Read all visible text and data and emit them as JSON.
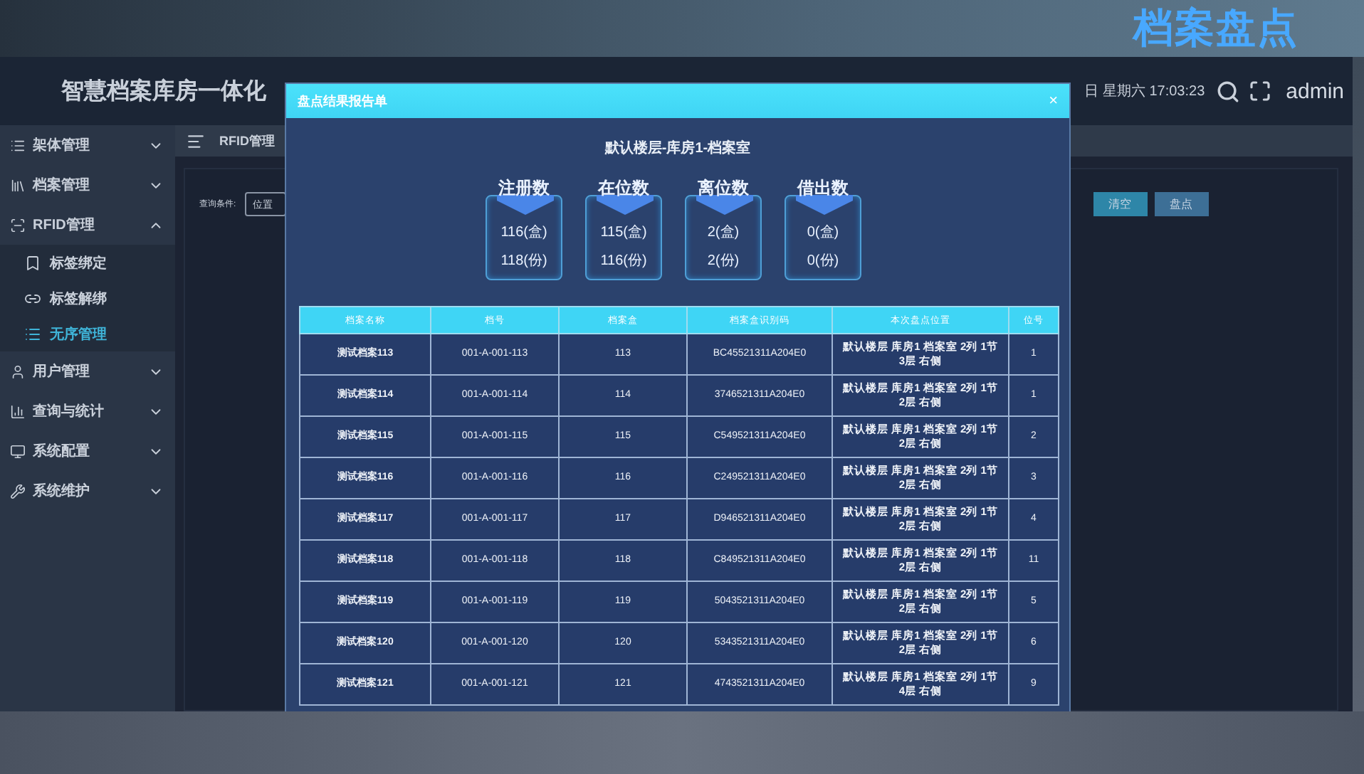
{
  "caption": "档案盘点",
  "header": {
    "title": "智慧档案库房一体化",
    "datetime": "日 星期六 17:03:23",
    "user": "admin"
  },
  "sidebar": {
    "items": [
      {
        "label": "架体管理",
        "expanded": false
      },
      {
        "label": "档案管理",
        "expanded": false
      },
      {
        "label": "RFID管理",
        "expanded": true,
        "children": [
          {
            "label": "标签绑定",
            "selected": false
          },
          {
            "label": "标签解绑",
            "selected": false
          },
          {
            "label": "无序管理",
            "selected": true
          }
        ]
      },
      {
        "label": "用户管理",
        "expanded": false
      },
      {
        "label": "查询与统计",
        "expanded": false
      },
      {
        "label": "系统配置",
        "expanded": false
      },
      {
        "label": "系统维护",
        "expanded": false
      }
    ]
  },
  "tab": {
    "label": "RFID管理"
  },
  "query": {
    "label": "查询条件:",
    "select_value": "位置",
    "buttons": [
      {
        "label": "清空",
        "kind": "primary"
      },
      {
        "label": "盘点",
        "kind": "secondary"
      }
    ]
  },
  "dialog": {
    "title": "盘点结果报告单",
    "close": "×",
    "subtitle": "默认楼层-库房1-档案室",
    "stats": [
      {
        "label": "注册数",
        "boxes": "116(盒)",
        "copies": "118(份)"
      },
      {
        "label": "在位数",
        "boxes": "115(盒)",
        "copies": "116(份)"
      },
      {
        "label": "离位数",
        "boxes": "2(盒)",
        "copies": "2(份)"
      },
      {
        "label": "借出数",
        "boxes": "0(盒)",
        "copies": "0(份)"
      }
    ],
    "table": {
      "columns": [
        "档案名称",
        "档号",
        "档案盒",
        "档案盒识别码",
        "本次盘点位置",
        "位号"
      ],
      "rows": [
        [
          "测试档案113",
          "001-A-001-113",
          "113",
          "BC45521311A204E0",
          "默认楼层 库房1 档案室 2列 1节 3层 右侧",
          "1"
        ],
        [
          "测试档案114",
          "001-A-001-114",
          "114",
          "3746521311A204E0",
          "默认楼层 库房1 档案室 2列 1节 2层 右侧",
          "1"
        ],
        [
          "测试档案115",
          "001-A-001-115",
          "115",
          "C549521311A204E0",
          "默认楼层 库房1 档案室 2列 1节 2层 右侧",
          "2"
        ],
        [
          "测试档案116",
          "001-A-001-116",
          "116",
          "C249521311A204E0",
          "默认楼层 库房1 档案室 2列 1节 2层 右侧",
          "3"
        ],
        [
          "测试档案117",
          "001-A-001-117",
          "117",
          "D946521311A204E0",
          "默认楼层 库房1 档案室 2列 1节 2层 右侧",
          "4"
        ],
        [
          "测试档案118",
          "001-A-001-118",
          "118",
          "C849521311A204E0",
          "默认楼层 库房1 档案室 2列 1节 2层 右侧",
          "11"
        ],
        [
          "测试档案119",
          "001-A-001-119",
          "119",
          "5043521311A204E0",
          "默认楼层 库房1 档案室 2列 1节 2层 右侧",
          "5"
        ],
        [
          "测试档案120",
          "001-A-001-120",
          "120",
          "5343521311A204E0",
          "默认楼层 库房1 档案室 2列 1节 2层 右侧",
          "6"
        ],
        [
          "测试档案121",
          "001-A-001-121",
          "121",
          "4743521311A204E0",
          "默认楼层 库房1 档案室 2列 1节 4层 右侧",
          "9"
        ]
      ]
    }
  }
}
